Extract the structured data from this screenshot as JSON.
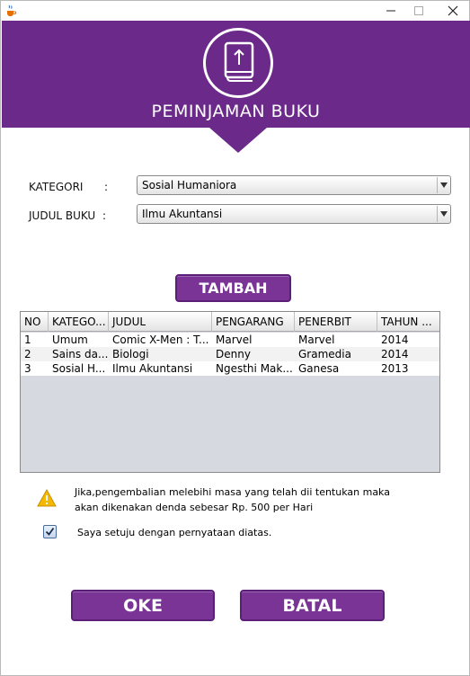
{
  "window": {
    "app_icon": "java-coffee-icon",
    "controls": {
      "minimize": "−",
      "maximize": "☐",
      "close": "✕"
    }
  },
  "header": {
    "title": "PEMINJAMAN BUKU",
    "logo_icon": "book-upload-icon",
    "color": "#6b2a8a"
  },
  "form": {
    "kategori_label": "KATEGORI",
    "judul_label": "JUDUL BUKU",
    "colon": ":",
    "kategori_value": "Sosial Humaniora",
    "judul_value": "Ilmu Akuntansi"
  },
  "buttons": {
    "tambah": "TAMBAH",
    "oke": "OKE",
    "batal": "BATAL",
    "color": "#7a3496"
  },
  "table": {
    "columns": [
      "NO",
      "KATEGO...",
      "JUDUL",
      "PENGARANG",
      "PENERBIT",
      "TAHUN ..."
    ],
    "rows": [
      [
        "1",
        "Umum",
        "Comic X-Men : T...",
        "Marvel",
        "Marvel",
        "2014"
      ],
      [
        "2",
        "Sains da...",
        "Biologi",
        "Denny",
        "Gramedia",
        "2014"
      ],
      [
        "3",
        "Sosial H...",
        "Ilmu Akuntansi",
        "Ngesthi Mak...",
        "Ganesa",
        "2013"
      ]
    ]
  },
  "notice": {
    "icon": "warning-icon",
    "line1": "Jika,pengembalian melebihi masa yang telah dii tentukan  maka",
    "line2": "akan dikenakan denda sebesar Rp. 500 per Hari",
    "agree_label": "Saya setuju dengan pernyataan diatas.",
    "agree_checked": true
  }
}
